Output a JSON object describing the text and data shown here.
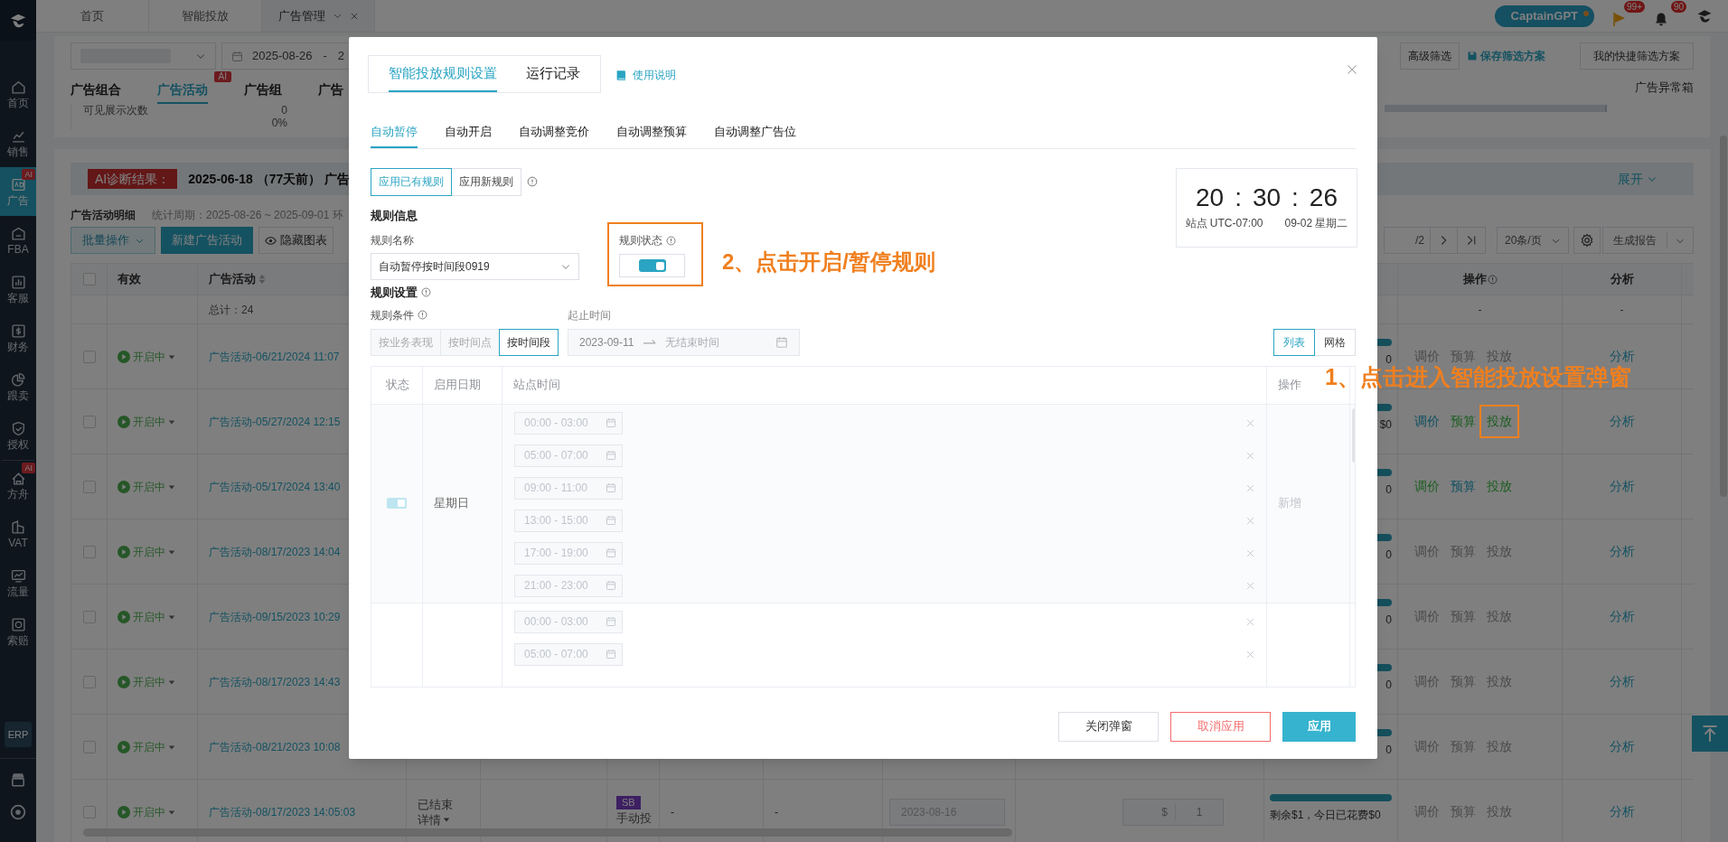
{
  "top_tabs": [
    {
      "label": "首页",
      "selected": false
    },
    {
      "label": "智能投放",
      "selected": false
    },
    {
      "label": "广告管理",
      "selected": true
    }
  ],
  "header": {
    "assistant": "CaptainGPT",
    "flag_count": "99+",
    "bell_count": "90"
  },
  "sidebar": {
    "items": [
      {
        "label": "首页",
        "selected": false
      },
      {
        "label": "销售",
        "selected": false
      },
      {
        "label": "广告",
        "selected": true,
        "badge": "AI"
      },
      {
        "label": "FBA",
        "selected": false
      },
      {
        "label": "客服",
        "selected": false
      },
      {
        "label": "财务",
        "selected": false
      },
      {
        "label": "跟卖",
        "selected": false
      },
      {
        "label": "授权",
        "selected": false
      },
      {
        "label": "方舟",
        "selected": false,
        "badge": "AI"
      },
      {
        "label": "VAT",
        "selected": false
      },
      {
        "label": "流量",
        "selected": false
      },
      {
        "label": "索赔",
        "selected": false
      }
    ],
    "erp": "ERP"
  },
  "filters": {
    "date_start": "2025-08-26",
    "date_separator": "-",
    "date_end": "2",
    "advanced": "高级筛选",
    "save_preset": "保存筛选方案",
    "my_presets": "我的快捷筛选方案"
  },
  "ad_tabs": [
    {
      "label": "广告组合",
      "selected": false
    },
    {
      "label": "广告活动",
      "selected": true,
      "badge": "AI"
    },
    {
      "label": "广告组",
      "selected": false
    },
    {
      "label": "广告",
      "selected": false
    }
  ],
  "anomaly_box": "广告异常箱",
  "summary": {
    "metric": "可见展示次数",
    "value": "0",
    "ratio": "0%"
  },
  "diagnosis": {
    "label": "AI诊断结果：",
    "text": "2025-06-18 （77天前） 广告",
    "expand": "展开"
  },
  "detail": {
    "title": "广告活动明细",
    "period": "统计周期：2025-08-26 ~ 2025-09-01 环"
  },
  "toolbar": {
    "batch": "批量操作",
    "create": "新建广告活动",
    "hide_chart": "隐藏图表",
    "page_total": "/2",
    "page_size": "20条/页",
    "report": "生成报告"
  },
  "table": {
    "all_checked": false,
    "columns": [
      "有效",
      "广告活动",
      "操作",
      "分析"
    ],
    "total": "总计：24",
    "total_actions": "-",
    "total_analysis": "-",
    "rows": [
      {
        "kind": "partial",
        "checked": false,
        "status": "开启中",
        "name": "广告活动-06/21/2024 11:07",
        "budget_tail": "0",
        "actions": [
          {
            "label": "调价",
            "color": "#4a4a4a"
          },
          {
            "label": "预算",
            "color": "#4a4a4a"
          },
          {
            "label": "投放",
            "color": "#4a4a4a"
          }
        ],
        "analysis": "分析"
      },
      {
        "kind": "partial",
        "checked": false,
        "status": "开启中",
        "name": "广告活动-05/27/2024 12:15",
        "budget_tail": "$0",
        "actions": [
          {
            "label": "调价",
            "color": "#0e4f60"
          },
          {
            "label": "预算",
            "color": "#1b5e20"
          },
          {
            "label": "投放",
            "color": "#1b5e20",
            "highlighted": true
          }
        ],
        "analysis": "分析"
      },
      {
        "kind": "partial",
        "checked": false,
        "status": "开启中",
        "name": "广告活动-05/17/2024 13:40",
        "budget_tail": "0",
        "actions": [
          {
            "label": "调价",
            "color": "#1b5e20"
          },
          {
            "label": "预算",
            "color": "#0e4f60"
          },
          {
            "label": "投放",
            "color": "#1b5e20"
          }
        ],
        "analysis": "分析"
      },
      {
        "kind": "partial",
        "checked": false,
        "status": "开启中",
        "name": "广告活动-08/17/2023 14:04",
        "budget_tail": "0",
        "actions": [
          {
            "label": "调价",
            "color": "#4a4a4a"
          },
          {
            "label": "预算",
            "color": "#4a4a4a"
          },
          {
            "label": "投放",
            "color": "#4a4a4a"
          }
        ],
        "analysis": "分析"
      },
      {
        "kind": "partial",
        "checked": false,
        "status": "开启中",
        "name": "广告活动-09/15/2023 10:29",
        "budget_tail": "0",
        "actions": [
          {
            "label": "调价",
            "color": "#4a4a4a"
          },
          {
            "label": "预算",
            "color": "#4a4a4a"
          },
          {
            "label": "投放",
            "color": "#4a4a4a"
          }
        ],
        "analysis": "分析"
      },
      {
        "kind": "partial",
        "checked": false,
        "status": "开启中",
        "name": "广告活动-08/17/2023 14:43",
        "budget_tail": "0",
        "actions": [
          {
            "label": "调价",
            "color": "#4a4a4a"
          },
          {
            "label": "预算",
            "color": "#4a4a4a"
          },
          {
            "label": "投放",
            "color": "#4a4a4a"
          }
        ],
        "analysis": "分析"
      },
      {
        "kind": "partial",
        "checked": false,
        "status": "开启中",
        "name": "广告活动-08/21/2023 10:08",
        "budget_tail": "0",
        "actions": [
          {
            "label": "调价",
            "color": "#4a4a4a"
          },
          {
            "label": "预算",
            "color": "#4a4a4a"
          },
          {
            "label": "投放",
            "color": "#4a4a4a"
          }
        ],
        "analysis": "分析"
      },
      {
        "kind": "full",
        "checked": false,
        "status": "开启中",
        "name": "广告活动-08/17/2023 14:05:03",
        "state": "已结束",
        "state_detail": "详情",
        "type_badge": "SB",
        "type": "手动投",
        "metric_a": "-",
        "metric_b": "-",
        "date": "2023-08-16",
        "bid_currency": "$",
        "bid": "1",
        "budget_text": "剩余$1，今日已花费$0",
        "actions": [
          {
            "label": "调价",
            "color": "#4a4a4a"
          },
          {
            "label": "预算",
            "color": "#4a4a4a"
          },
          {
            "label": "投放",
            "color": "#4a4a4a"
          }
        ],
        "analysis": "分析"
      }
    ]
  },
  "modal": {
    "tabs": [
      {
        "label": "智能投放规则设置",
        "selected": true
      },
      {
        "label": "运行记录",
        "selected": false
      }
    ],
    "help": "使用说明",
    "rule_tabs": [
      {
        "label": "自动暂停",
        "selected": true
      },
      {
        "label": "自动开启",
        "selected": false
      },
      {
        "label": "自动调整竞价",
        "selected": false
      },
      {
        "label": "自动调整预算",
        "selected": false
      },
      {
        "label": "自动调整广告位",
        "selected": false
      }
    ],
    "modes": [
      {
        "label": "应用已有规则",
        "selected": true
      },
      {
        "label": "应用新规则",
        "selected": false
      }
    ],
    "clock": {
      "time": [
        "20",
        ":",
        "30",
        ":",
        "26"
      ],
      "zone": "站点 UTC-07:00",
      "date": "09-02 星期二"
    },
    "info_title": "规则信息",
    "name_label": "规则名称",
    "name_value": "自动暂停按时间段0919",
    "status_label": "规则状态",
    "status_on": true,
    "status_highlighted": true,
    "settings_title": "规则设置",
    "condition_label": "规则条件",
    "conditions": [
      {
        "label": "按业务表现",
        "selected": false
      },
      {
        "label": "按时间点",
        "selected": false
      },
      {
        "label": "按时间段",
        "selected": true
      }
    ],
    "range_label": "起止时间",
    "range_start": "2023-09-11",
    "range_end_placeholder": "无结束时间",
    "views": [
      {
        "label": "列表",
        "selected": true
      },
      {
        "label": "网格",
        "selected": false
      }
    ],
    "schedule": {
      "columns": [
        "状态",
        "启用日期",
        "站点时间",
        "操作"
      ],
      "rows": [
        {
          "on": true,
          "day": "星期日",
          "action": "新增",
          "slots": [
            "00:00 - 03:00",
            "05:00 - 07:00",
            "09:00 - 11:00",
            "13:00 - 15:00",
            "17:00 - 19:00",
            "21:00 - 23:00"
          ]
        },
        {
          "slots": [
            "00:00 - 03:00",
            "05:00 - 07:00"
          ]
        }
      ]
    },
    "buttons": [
      {
        "label": "关闭弹窗",
        "kind": "default"
      },
      {
        "label": "取消应用",
        "kind": "danger"
      },
      {
        "label": "应用",
        "kind": "primary"
      }
    ]
  },
  "annotations": [
    {
      "text": "1、点击进入智能投放设置弹窗"
    },
    {
      "text": "2、点击开启/暂停规则"
    }
  ]
}
